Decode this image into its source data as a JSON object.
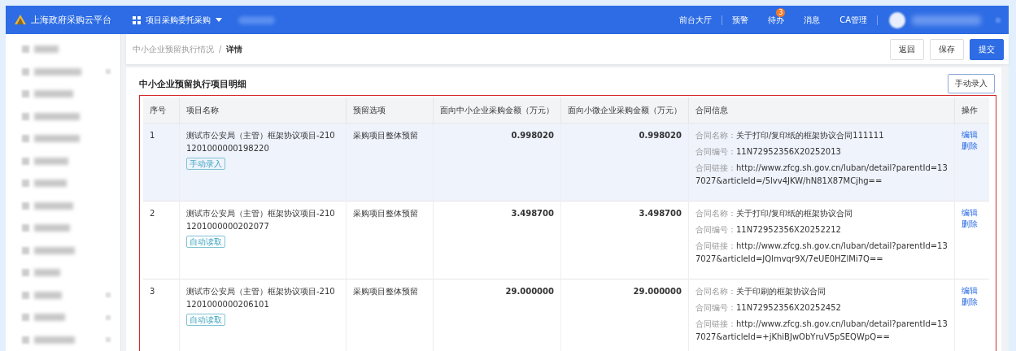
{
  "header": {
    "logo_text": "上海政府采购云平台",
    "module": "项目采购委托采购",
    "nav": [
      {
        "label": "前台大厅"
      },
      {
        "label": "预警"
      },
      {
        "label": "待办",
        "badge": "3"
      },
      {
        "label": "消息"
      },
      {
        "label": "CA管理"
      }
    ]
  },
  "sidebar": {
    "items": [
      {
        "expandable": false
      },
      {
        "expandable": true
      },
      {
        "expandable": false
      },
      {
        "expandable": false
      },
      {
        "expandable": false
      },
      {
        "expandable": false
      },
      {
        "expandable": false
      },
      {
        "expandable": false
      },
      {
        "expandable": false
      },
      {
        "expandable": false
      },
      {
        "expandable": false
      },
      {
        "expandable": true
      },
      {
        "expandable": true
      },
      {
        "expandable": true
      }
    ]
  },
  "breadcrumb": [
    {
      "label": "中小企业预留执行情况",
      "current": false
    },
    {
      "label": "详情",
      "current": true
    }
  ],
  "breadcrumb_separator": "/",
  "actions": [
    {
      "label": "返回",
      "kind": "default"
    },
    {
      "label": "保存",
      "kind": "default"
    },
    {
      "label": "提交",
      "kind": "primary"
    }
  ],
  "section": {
    "title": "中小企业预留执行项目明细",
    "add_button": "手动录入"
  },
  "table": {
    "columns": [
      "序号",
      "项目名称",
      "预留选项",
      "面向中小企业采购金额（万元）",
      "面向小微企业采购金额（万元）",
      "合同信息",
      "操作"
    ],
    "rows": [
      {
        "index": "1",
        "name": "测试市公安局（主管）框架协议项目-2101201000000198220",
        "tag": "手动录入",
        "option": "采购项目整体预留",
        "sme_amount": "0.998020",
        "micro_amount": "0.998020",
        "contract": [
          {
            "label": "合同名称：",
            "value": "关于打印/复印纸的框架协议合同111111"
          },
          {
            "label": "合同编号：",
            "value": "11N72952356X20252013"
          },
          {
            "label": "合同链接：",
            "value": "http://www.zfcg.sh.gov.cn/luban/detail?parentId=137027&articleId=/5lvv4JKW/hN81X87MCjhg=="
          }
        ],
        "ops": [
          "编辑",
          "删除"
        ],
        "highlighted": true
      },
      {
        "index": "2",
        "name": "测试市公安局（主管）框架协议项目-2101201000000202077",
        "tag": "自动读取",
        "option": "采购项目整体预留",
        "sme_amount": "3.498700",
        "micro_amount": "3.498700",
        "contract": [
          {
            "label": "合同名称：",
            "value": "关于打印/复印纸的框架协议合同"
          },
          {
            "label": "合同编号：",
            "value": "11N72952356X20252212"
          },
          {
            "label": "合同链接：",
            "value": "http://www.zfcg.sh.gov.cn/luban/detail?parentId=137027&articleId=JQlmvqr9X/7eUE0HZlMi7Q=="
          }
        ],
        "ops": [
          "编辑",
          "删除"
        ],
        "highlighted": false
      },
      {
        "index": "3",
        "name": "测试市公安局（主管）框架协议项目-2101201000000206101",
        "tag": "自动读取",
        "option": "采购项目整体预留",
        "sme_amount": "29.000000",
        "micro_amount": "29.000000",
        "contract": [
          {
            "label": "合同名称：",
            "value": "关于印刷的框架协议合同"
          },
          {
            "label": "合同编号：",
            "value": "11N72952356X20252452"
          },
          {
            "label": "合同链接：",
            "value": "http://www.zfcg.sh.gov.cn/luban/detail?parentId=137027&articleId=+jKhiBJwObYruV5pSEQWpQ=="
          }
        ],
        "ops": [
          "编辑",
          "删除"
        ],
        "highlighted": false
      }
    ]
  }
}
